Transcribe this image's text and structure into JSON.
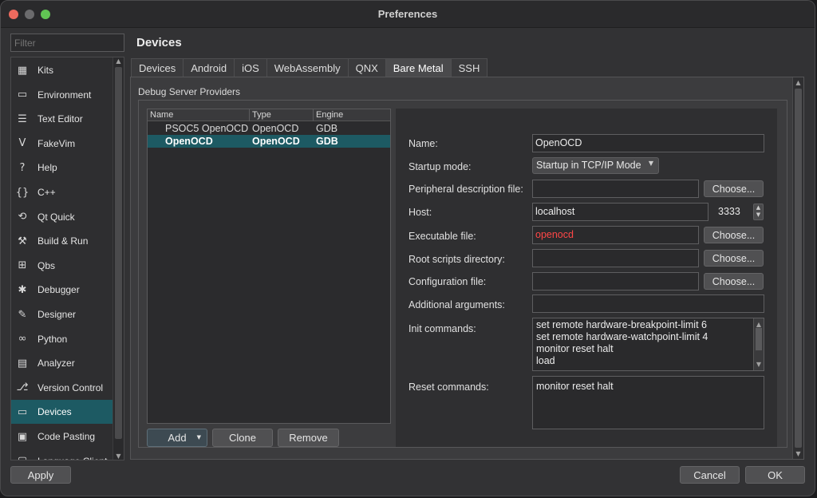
{
  "window": {
    "title": "Preferences"
  },
  "sidebar": {
    "filter_placeholder": "Filter",
    "items": [
      {
        "label": "Kits",
        "icon": "kits-icon",
        "glyph": "▦"
      },
      {
        "label": "Environment",
        "icon": "monitor-icon",
        "glyph": "▭"
      },
      {
        "label": "Text Editor",
        "icon": "text-editor-icon",
        "glyph": "☰"
      },
      {
        "label": "FakeVim",
        "icon": "fakevim-icon",
        "glyph": "V"
      },
      {
        "label": "Help",
        "icon": "help-icon",
        "glyph": "?"
      },
      {
        "label": "C++",
        "icon": "braces-icon",
        "glyph": "{}"
      },
      {
        "label": "Qt Quick",
        "icon": "qt-quick-icon",
        "glyph": "⟲"
      },
      {
        "label": "Build & Run",
        "icon": "hammer-icon",
        "glyph": "⚒"
      },
      {
        "label": "Qbs",
        "icon": "qbs-icon",
        "glyph": "⊞"
      },
      {
        "label": "Debugger",
        "icon": "bug-icon",
        "glyph": "✱"
      },
      {
        "label": "Designer",
        "icon": "pencil-icon",
        "glyph": "✎"
      },
      {
        "label": "Python",
        "icon": "python-icon",
        "glyph": "∞"
      },
      {
        "label": "Analyzer",
        "icon": "analyzer-icon",
        "glyph": "▤"
      },
      {
        "label": "Version Control",
        "icon": "version-control-icon",
        "glyph": "⎇"
      },
      {
        "label": "Devices",
        "icon": "devices-icon",
        "glyph": "▭"
      },
      {
        "label": "Code Pasting",
        "icon": "clipboard-icon",
        "glyph": "▣"
      },
      {
        "label": "Language Client",
        "icon": "language-client-icon",
        "glyph": "▢"
      }
    ],
    "selected": "Devices",
    "apply_label": "Apply"
  },
  "main": {
    "section_title": "Devices",
    "tabs": [
      "Devices",
      "Android",
      "iOS",
      "WebAssembly",
      "QNX",
      "Bare Metal",
      "SSH"
    ],
    "active_tab": "Bare Metal",
    "group_title": "Debug Server Providers",
    "table": {
      "columns": [
        "Name",
        "Type",
        "Engine"
      ],
      "rows": [
        {
          "name": "PSOC5 OpenOCD",
          "type": "OpenOCD",
          "engine": "GDB"
        },
        {
          "name": "OpenOCD",
          "type": "OpenOCD",
          "engine": "GDB"
        }
      ],
      "selected_row": 1
    },
    "buttons": {
      "add": "Add",
      "clone": "Clone",
      "remove": "Remove"
    },
    "form": {
      "name_label": "Name:",
      "name_value": "OpenOCD",
      "startup_label": "Startup mode:",
      "startup_value": "Startup in TCP/IP Mode",
      "peripheral_label": "Peripheral description file:",
      "peripheral_value": "",
      "host_label": "Host:",
      "host_value": "localhost",
      "port_value": "3333",
      "executable_label": "Executable file:",
      "executable_value": "openocd",
      "root_scripts_label": "Root scripts directory:",
      "root_scripts_value": "",
      "config_label": "Configuration file:",
      "config_value": "",
      "additional_args_label": "Additional arguments:",
      "additional_args_value": "",
      "init_label": "Init commands:",
      "init_lines": [
        "set remote hardware-breakpoint-limit 6",
        "set remote hardware-watchpoint-limit 4",
        "monitor reset halt",
        "load"
      ],
      "reset_label": "Reset commands:",
      "reset_lines": [
        "monitor reset halt"
      ],
      "choose_label": "Choose..."
    }
  },
  "footer": {
    "cancel": "Cancel",
    "ok": "OK"
  },
  "colors": {
    "accent": "#1d5a63",
    "error_text": "#ff4747"
  }
}
